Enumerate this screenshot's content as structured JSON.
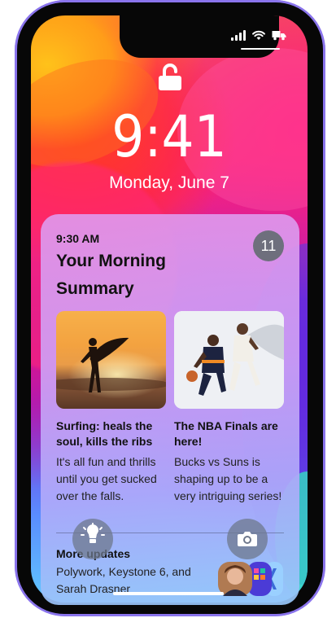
{
  "status_bar": {
    "icons": [
      "signal-icon",
      "wifi-icon",
      "truck-icon"
    ]
  },
  "lock_screen": {
    "lock_icon": "unlocked-padlock-icon",
    "time": "9:41",
    "date": "Monday, June 7"
  },
  "notification": {
    "time": "9:30 AM",
    "title": "Your Morning Summary",
    "count": "11",
    "stories": [
      {
        "headline": "Surfing: heals the soul, kills the ribs",
        "body": "It's all fun and thrills until you get sucked over the falls."
      },
      {
        "headline": "The NBA Finals are here!",
        "body": "Bucks vs Suns is shaping up to be a very intriguing series!"
      }
    ],
    "more": {
      "title": "More updates",
      "body": "Polywork, Keystone 6, and Sarah Drasner"
    }
  },
  "quick_actions": {
    "flashlight_icon": "flashlight-icon",
    "camera_icon": "camera-icon"
  },
  "colors": {
    "frame": "#9f8af0",
    "badge": "#6e6f7d",
    "text": "#111111"
  }
}
